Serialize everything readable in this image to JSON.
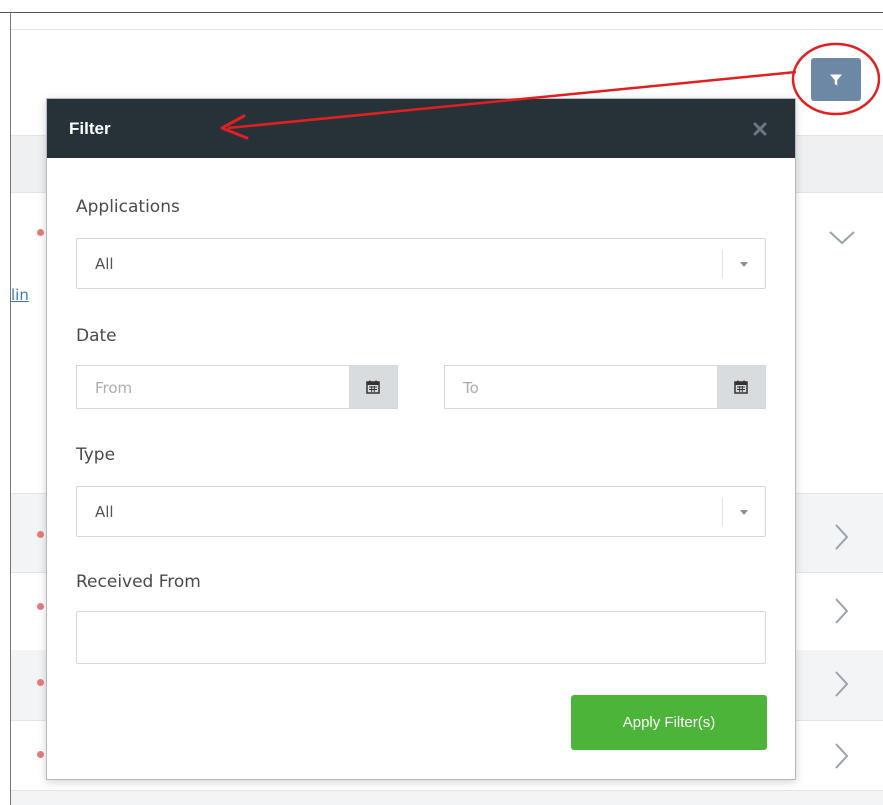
{
  "background": {
    "partial_link_text": "lin"
  },
  "toolbar": {
    "filter_button_icon": "filter-funnel-icon"
  },
  "modal": {
    "title": "Filter",
    "close_icon": "close-x-icon",
    "applications": {
      "label": "Applications",
      "selected": "All"
    },
    "date": {
      "label": "Date",
      "from_placeholder": "From",
      "to_placeholder": "To"
    },
    "type": {
      "label": "Type",
      "selected": "All"
    },
    "received_from": {
      "label": "Received From",
      "value": ""
    },
    "apply_label": "Apply Filter(s)"
  },
  "colors": {
    "modal_header": "#263238",
    "apply_button": "#4cb438",
    "filter_button": "#6d88a5",
    "annotation": "#e02020"
  }
}
